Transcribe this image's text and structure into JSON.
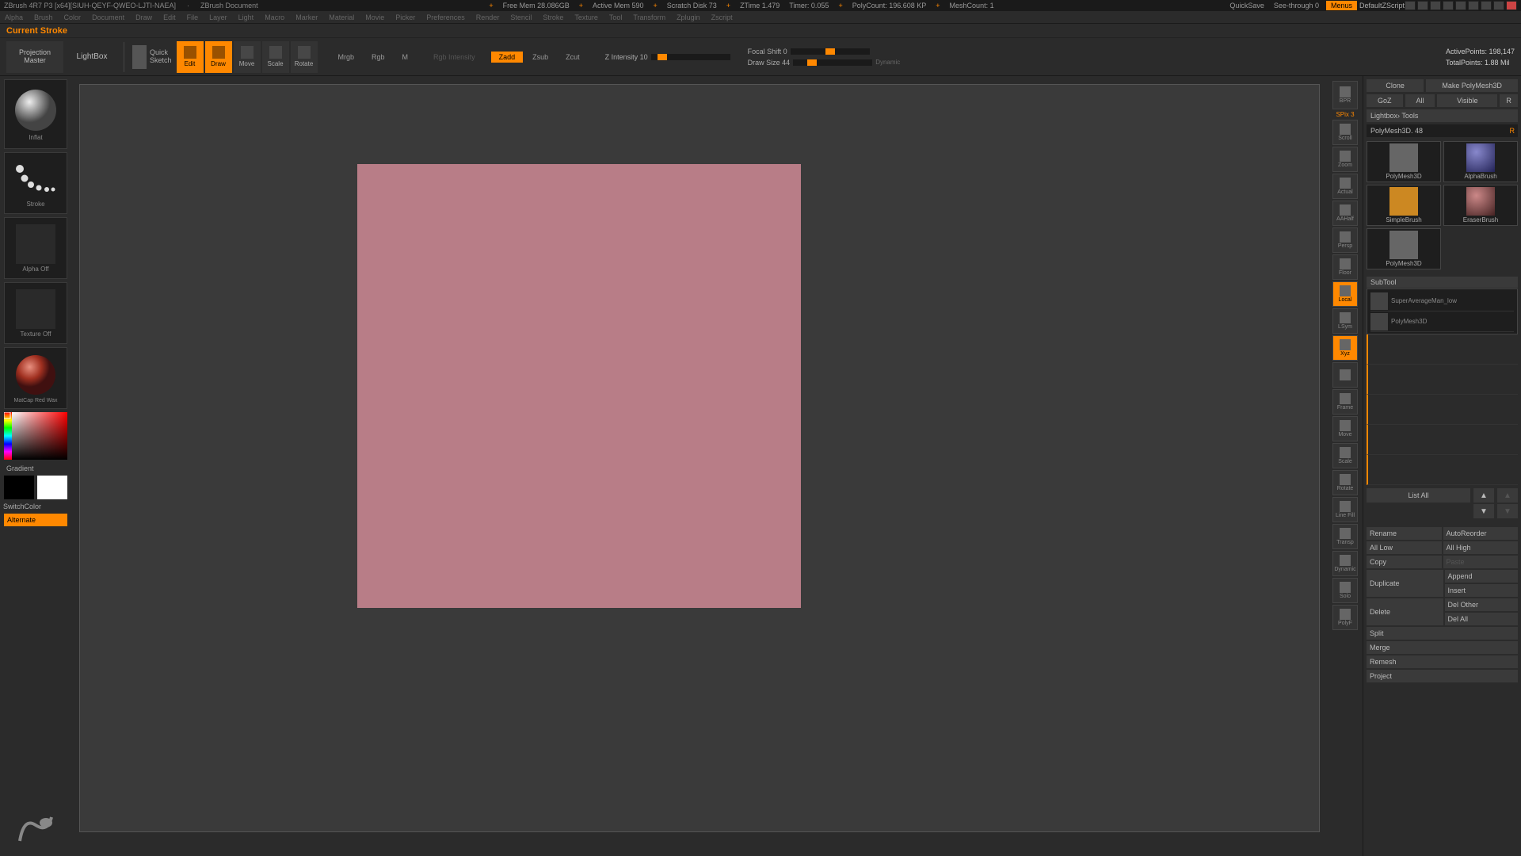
{
  "title": {
    "app": "ZBrush 4R7 P3 [x64][SIUH-QEYF-QWEO-LJTI-NAEA]",
    "doc": "ZBrush Document",
    "stats": {
      "free_mem": "Free Mem 28.086GB",
      "active_mem": "Active Mem 590",
      "scratch": "Scratch Disk 73",
      "ztime": "ZTime 1.479",
      "timer": "Timer: 0.055",
      "polycount": "PolyCount: 196.608 KP",
      "meshcount": "MeshCount: 1"
    },
    "quicksave": "QuickSave",
    "see_through": "See-through 0",
    "menus": "Menus",
    "script": "DefaultZScript"
  },
  "menubar": [
    "Alpha",
    "Brush",
    "Color",
    "Document",
    "Draw",
    "Edit",
    "File",
    "Layer",
    "Light",
    "Macro",
    "Marker",
    "Material",
    "Movie",
    "Picker",
    "Preferences",
    "Render",
    "Stencil",
    "Stroke",
    "Texture",
    "Tool",
    "Transform",
    "Zplugin",
    "Zscript"
  ],
  "info": {
    "label": "Current Stroke"
  },
  "shelf": {
    "projection": [
      "Projection",
      "Master"
    ],
    "lightbox": "LightBox",
    "quicksketch": [
      "Quick",
      "Sketch"
    ],
    "tools": [
      {
        "name": "edit-tool",
        "label": "Edit",
        "active": true
      },
      {
        "name": "draw-tool",
        "label": "Draw",
        "active": true
      },
      {
        "name": "move-tool",
        "label": "Move",
        "active": false
      },
      {
        "name": "scale-tool",
        "label": "Scale",
        "active": false
      },
      {
        "name": "rotate-tool",
        "label": "Rotate",
        "active": false
      }
    ],
    "modes": [
      {
        "name": "mrgb",
        "label": "Mrgb",
        "active": false
      },
      {
        "name": "rgb",
        "label": "Rgb",
        "active": false
      },
      {
        "name": "m",
        "label": "M",
        "active": false
      }
    ],
    "rgb_intensity": "Rgb Intensity",
    "zmodes": [
      {
        "name": "zadd",
        "label": "Zadd",
        "active": true
      },
      {
        "name": "zsub",
        "label": "Zsub",
        "active": false
      },
      {
        "name": "zcut",
        "label": "Zcut",
        "active": false
      }
    ],
    "z_intensity": "Z Intensity 10",
    "focal_shift": "Focal Shift 0",
    "draw_size": "Draw Size 44",
    "dynamic": "Dynamic",
    "active_points": "ActivePoints: 198,147",
    "total_points": "TotalPoints: 1.88 Mil"
  },
  "left": {
    "brush": "Inflat",
    "stroke": "Stroke",
    "alpha": "Alpha Off",
    "texture": "Texture Off",
    "material": "MatCap Red Wax",
    "gradient": "Gradient",
    "switch": "SwitchColor",
    "alternate": "Alternate"
  },
  "rightstrip": {
    "spix": "SPix 3",
    "items": [
      {
        "name": "bpr",
        "label": "BPR"
      },
      {
        "name": "scroll",
        "label": "Scroll"
      },
      {
        "name": "zoom",
        "label": "Zoom"
      },
      {
        "name": "actual",
        "label": "Actual"
      },
      {
        "name": "aahalf",
        "label": "AAHalf"
      },
      {
        "name": "persp",
        "label": "Persp"
      },
      {
        "name": "floor",
        "label": "Floor"
      },
      {
        "name": "local",
        "label": "Local",
        "active": true
      },
      {
        "name": "lsym",
        "label": "LSym"
      },
      {
        "name": "xyz",
        "label": "Xyz",
        "active": true
      },
      {
        "name": "xpose",
        "label": ""
      },
      {
        "name": "frame",
        "label": "Frame"
      },
      {
        "name": "move-nav",
        "label": "Move"
      },
      {
        "name": "scale-nav",
        "label": "Scale"
      },
      {
        "name": "rotate-nav",
        "label": "Rotate"
      },
      {
        "name": "linefill",
        "label": "Line Fill"
      },
      {
        "name": "transp",
        "label": "Transp"
      },
      {
        "name": "dynamic",
        "label": "Dynamic"
      },
      {
        "name": "solo",
        "label": "Solo"
      },
      {
        "name": "polyf",
        "label": "PolyF"
      }
    ]
  },
  "panel": {
    "clone": "Clone",
    "makepm": "Make PolyMesh3D",
    "goz": "GoZ",
    "all": "All",
    "visible": "Visible",
    "r": "R",
    "lightbox_tools": "Lightbox› Tools",
    "active_tool": "PolyMesh3D. 48",
    "tools": [
      {
        "name": "polymesh3d",
        "label": "PolyMesh3D"
      },
      {
        "name": "alphabrush",
        "label": "AlphaBrush"
      },
      {
        "name": "simplebrush",
        "label": "SimpleBrush"
      },
      {
        "name": "eraserbrush",
        "label": "EraserBrush"
      },
      {
        "name": "polymesh3d-2",
        "label": "PolyMesh3D"
      }
    ],
    "subtool": "SubTool",
    "subtools": [
      {
        "name": "subtool-superaverage",
        "label": "SuperAverageMan_low"
      },
      {
        "name": "subtool-polymesh",
        "label": "PolyMesh3D"
      }
    ],
    "slots": [
      "",
      "",
      "",
      "",
      ""
    ],
    "listall": "List All",
    "buttons": {
      "rename": "Rename",
      "autoreorder": "AutoReorder",
      "alllow": "All Low",
      "allhigh": "All High",
      "copy": "Copy",
      "paste": "Paste",
      "duplicate": "Duplicate",
      "append": "Append",
      "insert": "Insert",
      "delete": "Delete",
      "delother": "Del Other",
      "delall": "Del All",
      "split": "Split",
      "merge": "Merge",
      "remesh": "Remesh",
      "project": "Project"
    }
  },
  "chart_data": null
}
